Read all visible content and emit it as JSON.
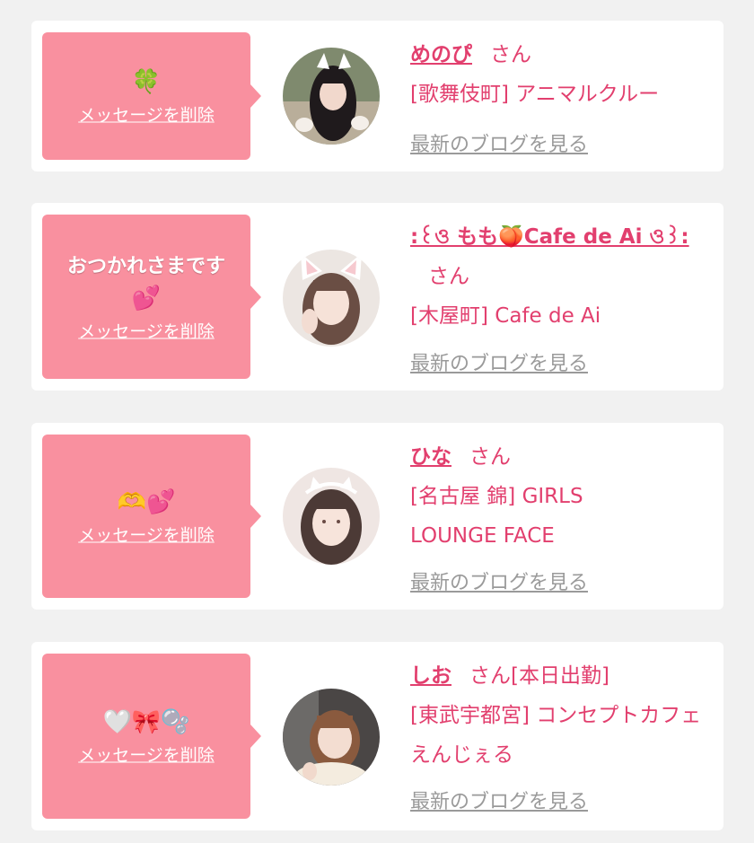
{
  "cards": [
    {
      "message": "",
      "emoji": "🍀",
      "delete_label": "メッセージを削除",
      "name": "めのぴ",
      "honorific": "さん",
      "work_status": "",
      "shop": "[歌舞伎町] アニマルクルー",
      "blog_link": "最新のブログを見る"
    },
    {
      "message": "おつかれさまです",
      "emoji": "💕",
      "delete_label": "メッセージを削除",
      "name": ":꒰ও もも🍑Cafe de Ai ও꒱:",
      "honorific": "さん",
      "work_status": "",
      "shop": "[木屋町] Cafe de Ai",
      "blog_link": "最新のブログを見る"
    },
    {
      "message": "",
      "emoji": "🫶💕",
      "delete_label": "メッセージを削除",
      "name": "ひな",
      "honorific": "さん",
      "work_status": "",
      "shop": "[名古屋 錦] GIRLS LOUNGE FACE",
      "blog_link": "最新のブログを見る"
    },
    {
      "message": "",
      "emoji": "🤍🎀🫧",
      "delete_label": "メッセージを削除",
      "name": "しお",
      "honorific": "さん",
      "work_status": "[本日出勤]",
      "shop": "[東武宇都宮] コンセプトカフェ えんじぇる",
      "blog_link": "最新のブログを見る"
    }
  ],
  "colors": {
    "bubble": "#f9909f",
    "accent_text": "#e23f6e",
    "link_gray": "#9a9a9a",
    "background": "#f1f1f1"
  }
}
